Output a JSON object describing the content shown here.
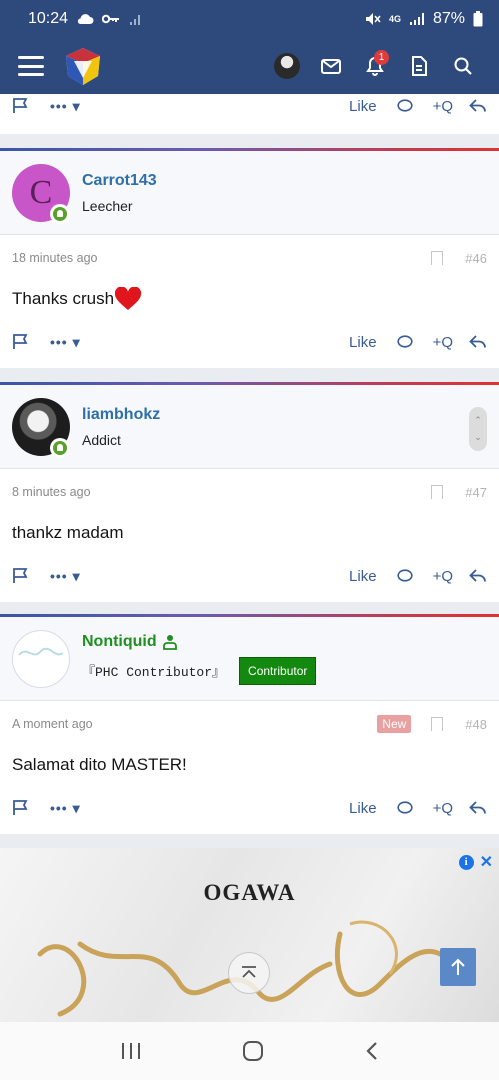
{
  "status": {
    "time": "10:24",
    "battery": "87%",
    "network": "4G"
  },
  "appbar": {
    "notif_count": "1"
  },
  "action_labels": {
    "like": "Like",
    "quote": "+Q"
  },
  "posts": [
    {
      "username": "Carrot143",
      "avatar_letter": "C",
      "user_title": "Leecher",
      "time": "18 minutes ago",
      "number": "#46",
      "message": "Thanks crush"
    },
    {
      "username": "liambhokz",
      "user_title": "Addict",
      "time": "8 minutes ago",
      "number": "#47",
      "message": "thankz madam"
    },
    {
      "username": "Nontiquid",
      "user_title": "『PHC Contributor』",
      "contributor_badge": "Contributor",
      "time": "A moment ago",
      "new_label": "New",
      "number": "#48",
      "message": "Salamat dito MASTER!"
    }
  ],
  "ad": {
    "brand": "OGAWA"
  },
  "colors": {
    "header": "#2e4a7c",
    "username": "#2f6fa8",
    "contributor_username": "#1f8f1f",
    "contributor_badge": "#138a0f",
    "online": "#5aa02c"
  }
}
